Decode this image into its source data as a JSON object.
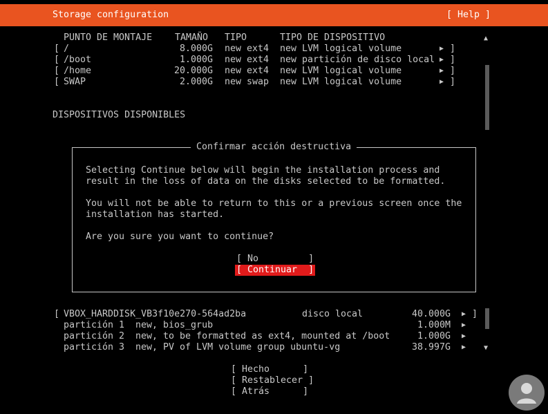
{
  "header": {
    "title": "Storage configuration",
    "help": "[ Help ]"
  },
  "mounts": {
    "columns": [
      "PUNTO DE MONTAJE",
      "TAMAÑO",
      "TIPO",
      "TIPO DE DISPOSITIVO"
    ],
    "rows": [
      {
        "open": "[",
        "mount": "/",
        "size": "8.000G",
        "type": "new ext4",
        "device": "new LVM logical volume",
        "arrow": "▶",
        "close": "]"
      },
      {
        "open": "[",
        "mount": "/boot",
        "size": "1.000G",
        "type": "new ext4",
        "device": "new partición de disco local",
        "arrow": "▶",
        "close": "]"
      },
      {
        "open": "[",
        "mount": "/home",
        "size": "20.000G",
        "type": "new ext4",
        "device": "new LVM logical volume",
        "arrow": "▶",
        "close": "]"
      },
      {
        "open": "[",
        "mount": "SWAP",
        "size": "2.000G",
        "type": "new swap",
        "device": "new LVM logical volume",
        "arrow": "▶",
        "close": "]"
      }
    ]
  },
  "available_title": "DISPOSITIVOS DISPONIBLES",
  "dialog": {
    "title": "Confirmar acción destructiva",
    "lines": [
      "Selecting Continue below will begin the installation process and",
      "result in the loss of data on the disks selected to be formatted.",
      "You will not be able to return to this or a previous screen once the",
      "installation has started.",
      "Are you sure you want to continue?"
    ],
    "no_button": "[ No         ]",
    "continue_button": "[ Continuar  ]"
  },
  "disk": {
    "open": "[",
    "name": "VBOX_HARDDISK_VB3f10e270-564ad2ba",
    "type": "disco local",
    "size": "40.000G",
    "arrow": "▶",
    "close": "]",
    "partitions": [
      {
        "name": "partición 1",
        "desc": "new, bios_grub",
        "size": "1.000M",
        "arrow": "▶"
      },
      {
        "name": "partición 2",
        "desc": "new, to be formatted as ext4, mounted at /boot",
        "size": "1.000G",
        "arrow": "▶"
      },
      {
        "name": "partición 3",
        "desc": "new, PV of LVM volume group ubuntu-vg",
        "size": "38.997G",
        "arrow": "▶"
      }
    ]
  },
  "scroll": {
    "up": "▲",
    "down": "▼"
  },
  "footer": {
    "done": "[ Hecho      ]",
    "reset": "[ Restablecer ]",
    "back": "[ Atrás      ]"
  }
}
